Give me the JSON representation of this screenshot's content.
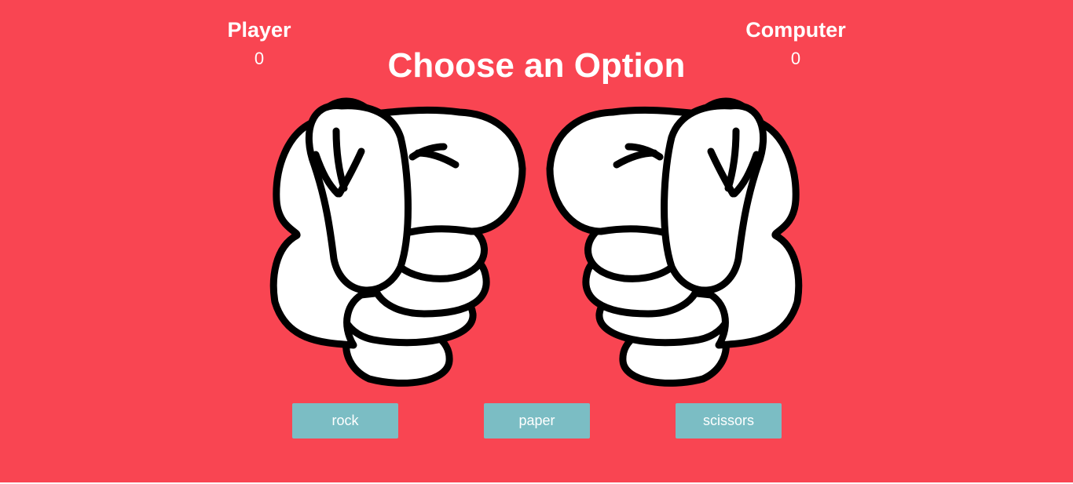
{
  "theme": {
    "background": "#f94552",
    "button": "#7bbdc4",
    "text": "#ffffff"
  },
  "scoreboard": {
    "player": {
      "label": "Player",
      "score": "0"
    },
    "computer": {
      "label": "Computer",
      "score": "0"
    }
  },
  "title": "Choose an Option",
  "hands": {
    "player": {
      "icon": "rock-fist-icon"
    },
    "computer": {
      "icon": "rock-fist-icon"
    }
  },
  "choices": [
    {
      "label": "rock"
    },
    {
      "label": "paper"
    },
    {
      "label": "scissors"
    }
  ]
}
